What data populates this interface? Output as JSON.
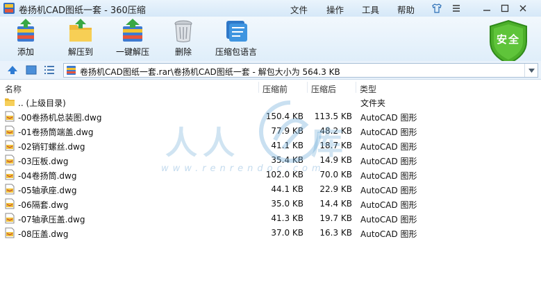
{
  "window": {
    "title": "卷扬机CAD图纸一套 - 360压缩",
    "menu": [
      "文件",
      "操作",
      "工具",
      "帮助"
    ]
  },
  "toolbar": {
    "buttons": [
      {
        "label": "添加",
        "icon": "add-archive-icon"
      },
      {
        "label": "解压到",
        "icon": "extract-to-icon"
      },
      {
        "label": "一键解压",
        "icon": "one-click-extract-icon"
      },
      {
        "label": "删除",
        "icon": "trash-icon"
      },
      {
        "label": "压缩包语言",
        "icon": "archive-language-icon"
      }
    ],
    "security_badge": "安全"
  },
  "address": {
    "path": "卷扬机CAD图纸一套.rar\\卷扬机CAD图纸一套 - 解包大小为 564.3 KB"
  },
  "columns": {
    "name": "名称",
    "packed": "压缩前",
    "original": "压缩后",
    "type": "类型"
  },
  "files": [
    {
      "name": ".. (上级目录)",
      "packed": "",
      "original": "",
      "type": "文件夹",
      "kind": "folder"
    },
    {
      "name": "-00卷扬机总装图.dwg",
      "packed": "150.4 KB",
      "original": "113.5 KB",
      "type": "AutoCAD 图形",
      "kind": "dwg"
    },
    {
      "name": "-01卷扬筒端盖.dwg",
      "packed": "77.9 KB",
      "original": "48.2 KB",
      "type": "AutoCAD 图形",
      "kind": "dwg"
    },
    {
      "name": "-02销钉螺丝.dwg",
      "packed": "41.1 KB",
      "original": "18.7 KB",
      "type": "AutoCAD 图形",
      "kind": "dwg"
    },
    {
      "name": "-03压板.dwg",
      "packed": "35.4 KB",
      "original": "14.9 KB",
      "type": "AutoCAD 图形",
      "kind": "dwg"
    },
    {
      "name": "-04卷扬筒.dwg",
      "packed": "102.0 KB",
      "original": "70.0 KB",
      "type": "AutoCAD 图形",
      "kind": "dwg"
    },
    {
      "name": "-05轴承座.dwg",
      "packed": "44.1 KB",
      "original": "22.9 KB",
      "type": "AutoCAD 图形",
      "kind": "dwg"
    },
    {
      "name": "-06隔套.dwg",
      "packed": "35.0 KB",
      "original": "14.4 KB",
      "type": "AutoCAD 图形",
      "kind": "dwg"
    },
    {
      "name": "-07轴承压盖.dwg",
      "packed": "41.3 KB",
      "original": "19.7 KB",
      "type": "AutoCAD 图形",
      "kind": "dwg"
    },
    {
      "name": "-08压盖.dwg",
      "packed": "37.0 KB",
      "original": "16.3 KB",
      "type": "AutoCAD 图形",
      "kind": "dwg"
    }
  ],
  "watermark": {
    "chars": [
      "人",
      "人",
      "库"
    ],
    "url": "www.renrendoc.com"
  },
  "colors": {
    "titlebar": "#d5e8f8",
    "toolbar": "#dfeefa",
    "shield": "#4caf2a",
    "folder": "#f0c040"
  }
}
